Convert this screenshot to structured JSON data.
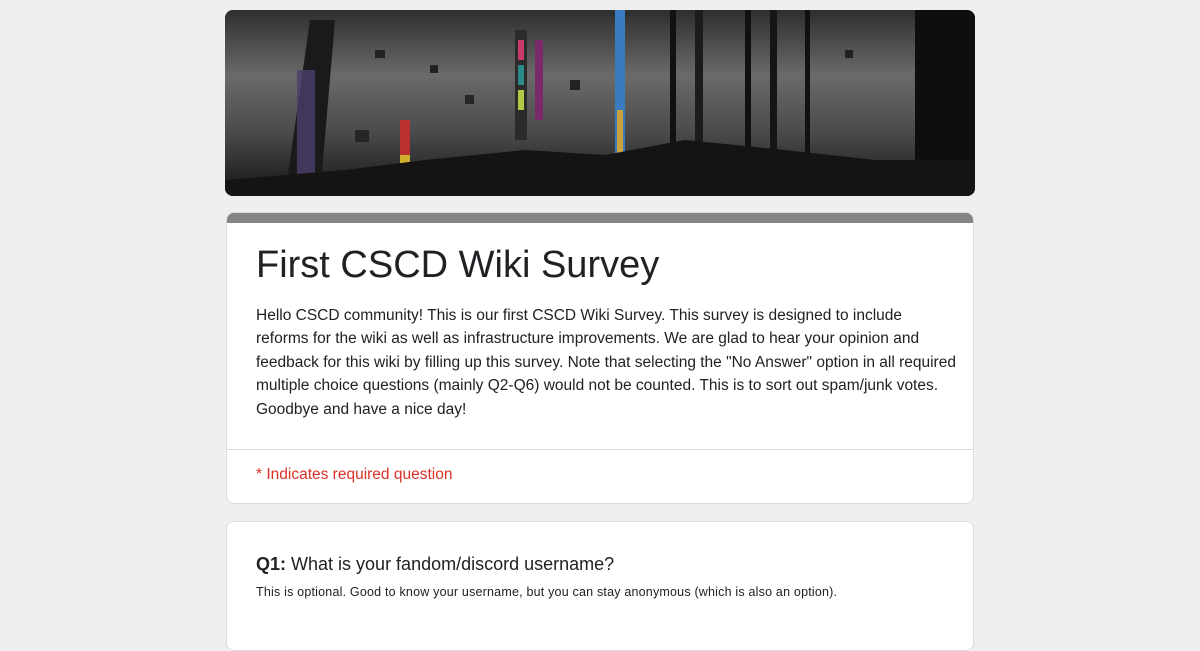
{
  "form": {
    "title": "First CSCD Wiki Survey",
    "description": "Hello CSCD community! This is our first CSCD Wiki Survey. This survey is designed to include reforms for the wiki as well as infrastructure improvements. We are glad to hear your opinion and feedback for this wiki by filling up this survey. Note that selecting the \"No Answer\" option in all required multiple choice questions (mainly Q2-Q6) would not be counted. This is to sort out spam/junk votes. Goodbye and have a nice day!",
    "required_note": "* Indicates required question"
  },
  "questions": [
    {
      "number": "Q1:",
      "text": "What is your fandom/discord username?",
      "help": "This is optional. Good to know your username, but you can stay anonymous (which is also an option)."
    }
  ],
  "colors": {
    "page_background": "#f0efef",
    "accent_bar": "#858585",
    "required_text": "#d93025",
    "card_border": "#dadce0"
  }
}
